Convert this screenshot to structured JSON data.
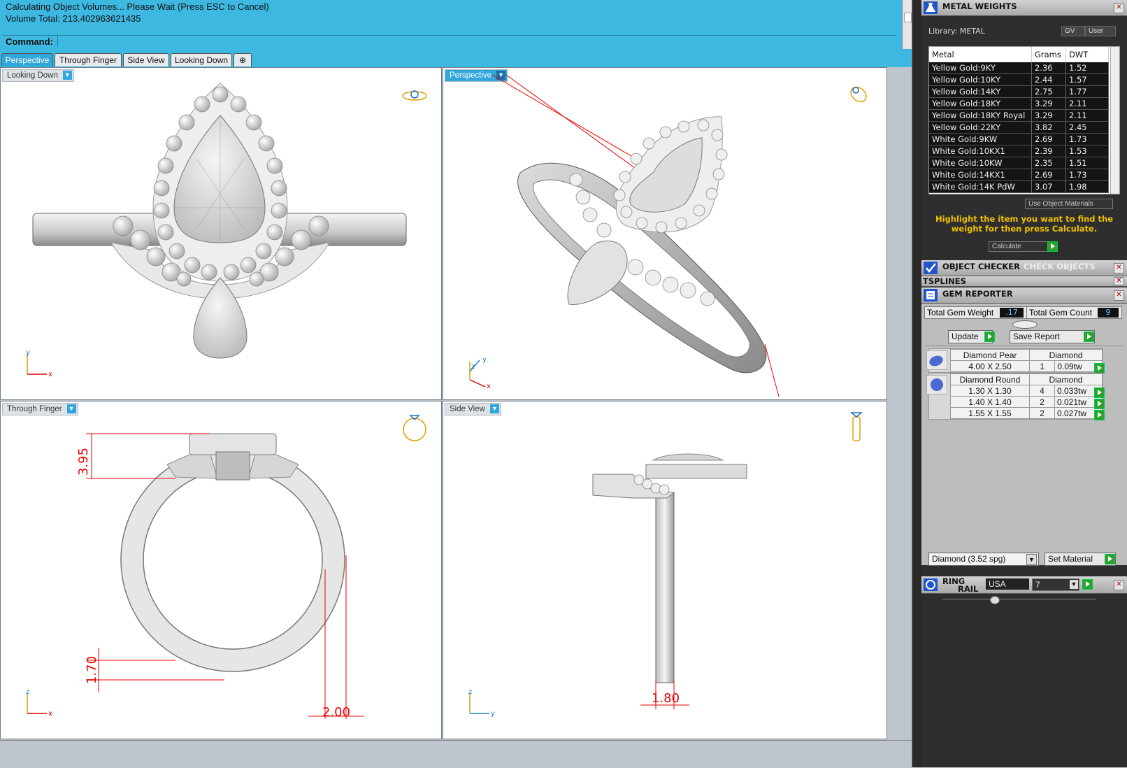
{
  "command": {
    "line1": "Calculating Object Volumes... Please Wait (Press ESC to Cancel)",
    "line2": "Volume Total: 213.402963621435",
    "prompt": "Command:"
  },
  "tabs": [
    "Perspective",
    "Through Finger",
    "Side View",
    "Looking Down"
  ],
  "viewports": {
    "top_left": {
      "label": "Looking Down",
      "axis_x": "x",
      "axis_y": "y"
    },
    "top_right": {
      "label": "Perspective",
      "axis_x": "x",
      "axis_y": "y",
      "axis_z": "z"
    },
    "bottom_left": {
      "label": "Through Finger",
      "axis_x": "x",
      "axis_y": "z",
      "dims": [
        "3.95",
        "1.70",
        "2.00"
      ]
    },
    "bottom_right": {
      "label": "Side View",
      "axis_x": "y",
      "axis_y": "z",
      "dims": [
        "1.80"
      ]
    }
  },
  "metal_weights": {
    "title": "METAL WEIGHTS",
    "library_label": "Library: METAL",
    "gv": "GV",
    "user": "User",
    "columns": [
      "Metal",
      "Grams",
      "DWT"
    ],
    "rows": [
      [
        "Yellow Gold:9KY",
        "2.36",
        "1.52"
      ],
      [
        "Yellow Gold:10KY",
        "2.44",
        "1.57"
      ],
      [
        "Yellow Gold:14KY",
        "2.75",
        "1.77"
      ],
      [
        "Yellow Gold:18KY",
        "3.29",
        "2.11"
      ],
      [
        "Yellow Gold:18KY Royal",
        "3.29",
        "2.11"
      ],
      [
        "Yellow Gold:22KY",
        "3.82",
        "2.45"
      ],
      [
        "White Gold:9KW",
        "2.69",
        "1.73"
      ],
      [
        "White Gold:10KX1",
        "2.39",
        "1.53"
      ],
      [
        "White Gold:10KW",
        "2.35",
        "1.51"
      ],
      [
        "White Gold:14KX1",
        "2.69",
        "1.73"
      ],
      [
        "White Gold:14K PdW",
        "3.07",
        "1.98"
      ]
    ],
    "use_object_materials": "Use Object Materials",
    "hint": "Highlight the item you want to find the weight for then press Calculate.",
    "calculate": "Calculate"
  },
  "object_checker": {
    "title": "OBJECT CHECKER",
    "check": "CHECK OBJECTS"
  },
  "tsplines": {
    "title": "TSPLINES"
  },
  "gem_reporter": {
    "title": "GEM REPORTER",
    "total_weight_label": "Total Gem Weight",
    "total_weight": ".17",
    "total_count_label": "Total Gem Count",
    "total_count": "9",
    "update": "Update",
    "save_report": "Save Report",
    "groups": [
      {
        "name": "Diamond Pear",
        "material": "Diamond",
        "rows": [
          [
            "4.00 X 2.50",
            "1",
            "0.09tw"
          ]
        ]
      },
      {
        "name": "Diamond Round",
        "material": "Diamond",
        "rows": [
          [
            "1.30 X 1.30",
            "4",
            "0.033tw"
          ],
          [
            "1.40 X 1.40",
            "2",
            "0.021tw"
          ],
          [
            "1.55 X 1.55",
            "2",
            "0.027tw"
          ]
        ]
      }
    ],
    "material_select": "Diamond    (3.52 spg)",
    "set_material": "Set Material"
  },
  "ring_rail": {
    "title1": "RING",
    "title2": "RAIL",
    "region": "USA",
    "size": "7"
  },
  "colors": {
    "accent": "#3db8e0",
    "panel_bg": "#2e2e2e",
    "hint": "#f0c000",
    "dim_red": "#e00000"
  }
}
